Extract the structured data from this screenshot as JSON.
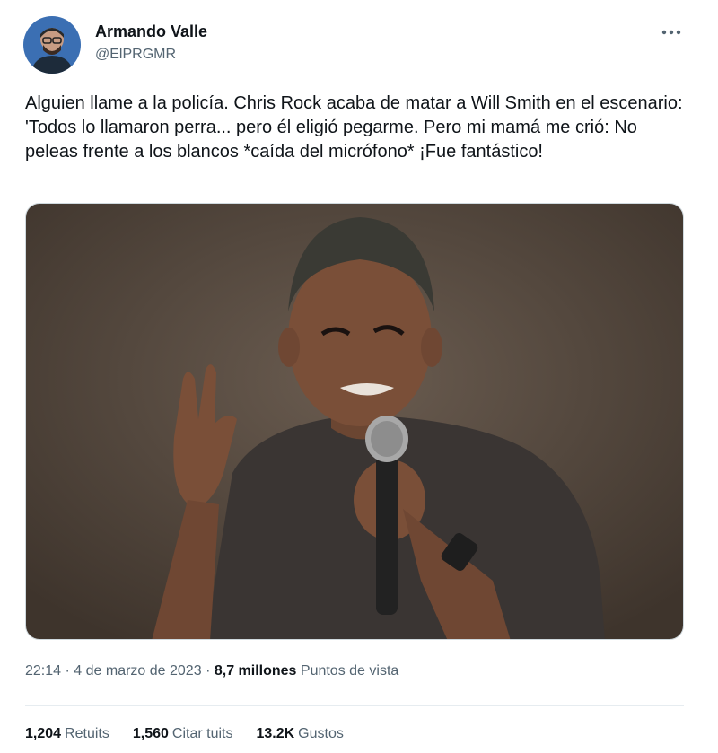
{
  "author": {
    "name": "Armando Valle",
    "handle": "@ElPRGMR"
  },
  "more_icon": "more-horizontal-icon",
  "tweet": {
    "text": "Alguien llame a la policía. Chris Rock acaba de matar a Will Smith en el escenario: 'Todos lo llamaron perra... pero él eligió pegarme. Pero mi mamá me crió: No peleas frente a los blancos *caída del micrófono* ¡Fue fantástico!"
  },
  "meta": {
    "time": "22:14",
    "separator": "·",
    "date": "4 de marzo de 2023",
    "views_count": "8,7 millones",
    "views_label": "Puntos de vista"
  },
  "stats": {
    "retweets_count": "1,204",
    "retweets_label": "Retuits",
    "quotes_count": "1,560",
    "quotes_label": "Citar tuits",
    "likes_count": "13.2K",
    "likes_label": "Gustos"
  },
  "colors": {
    "text_primary": "#0f1419",
    "text_secondary": "#536471",
    "photo_background": "#5a4d42"
  }
}
